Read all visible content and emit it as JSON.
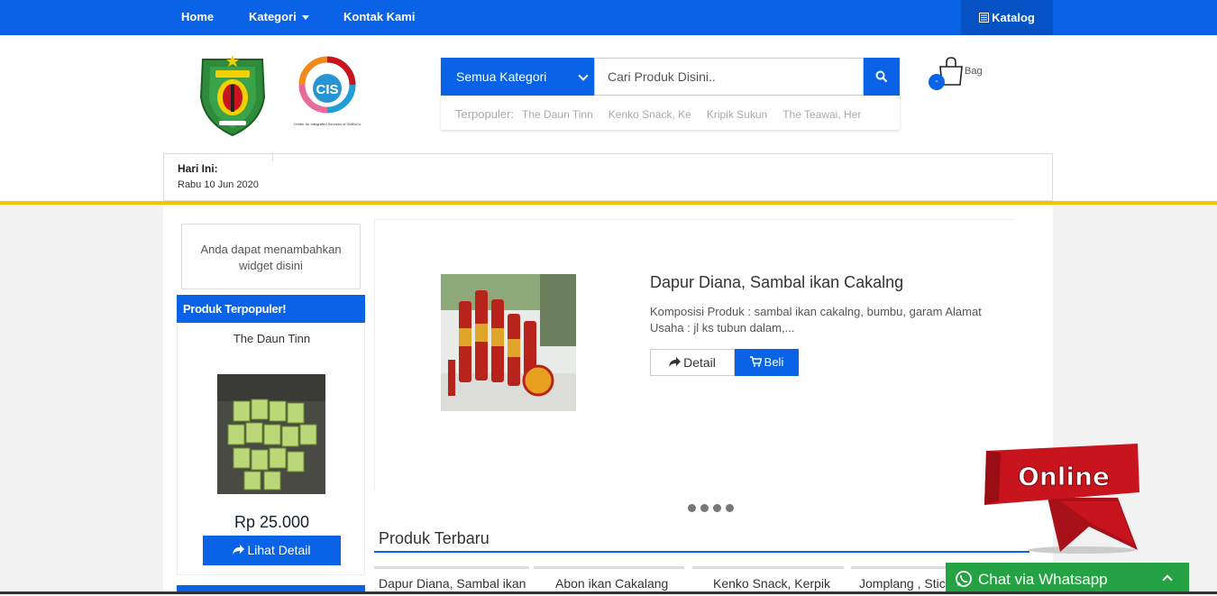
{
  "topbar": {
    "nav": [
      "Home",
      "Kategori",
      "Kontak Kami"
    ],
    "katalog_label": "Katalog"
  },
  "search": {
    "category_label": "Semua Kategori",
    "placeholder": "Cari Produk Disini..",
    "popular_label": "Terpopuler:",
    "popular_items": [
      "The Daun Tinn",
      "Kenko Snack, Ke",
      "Kripik Sukun",
      "The Teawai, Her"
    ]
  },
  "cart": {
    "label": "Bag",
    "count": "-"
  },
  "logo2": {
    "text": "CIS",
    "caption": "Center for Integrated Services of SMEsCo"
  },
  "today": {
    "label": "Hari Ini:",
    "date": "Rabu 10 Jun 2020"
  },
  "sidebar": {
    "widget_text": "Anda dapat menambahkan widget disini",
    "popular_heading": "Produk Terpopuler!",
    "product_name": "The Daun Tinn",
    "product_price": "Rp 25.000",
    "detail_button": "Lihat Detail"
  },
  "slider": {
    "title": "Dapur Diana, Sambal ikan Cakalng",
    "description": "Komposisi Produk : sambal ikan cakalng, bumbu, garam Alamat Usaha : jl ks tubun dalam,...",
    "detail_button": "Detail",
    "buy_button": "Beli"
  },
  "latest": {
    "title": "Produk Terbaru",
    "products": [
      "Dapur Diana, Sambal ikan",
      "Abon ikan Cakalang",
      "Kenko Snack, Kerpik",
      "Jomplang , Stick"
    ]
  },
  "online_badge": "Online",
  "whatsapp_label": "Chat via Whatsapp",
  "colors": {
    "primary": "#0a63e6",
    "accent_yellow": "#f5c400",
    "whatsapp": "#25a244",
    "online_red": "#c8141c"
  }
}
